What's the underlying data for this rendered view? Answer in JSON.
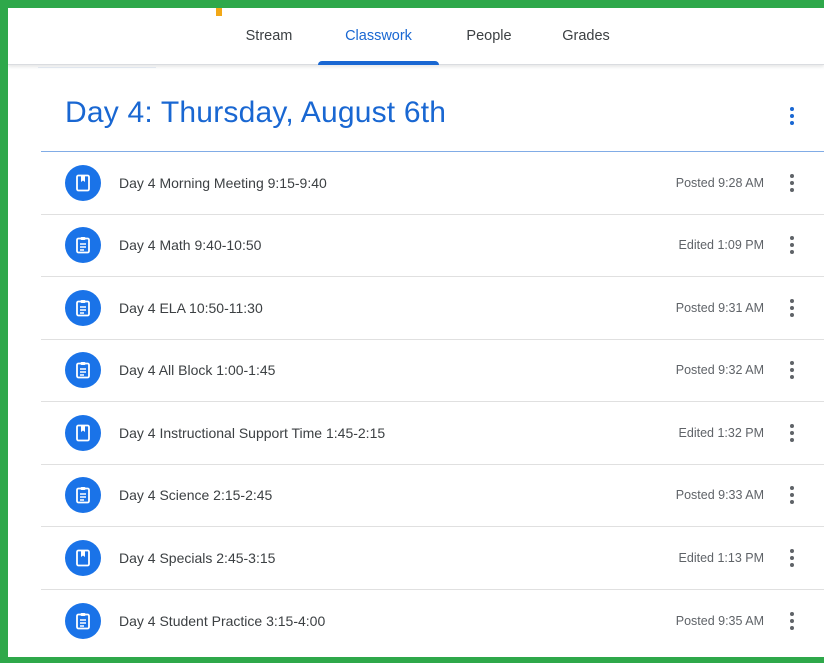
{
  "colors": {
    "accent": "#1967d2",
    "icon_bg": "#1a73e8",
    "frame": "#2ea84a",
    "marker": "#f2a817"
  },
  "nav": {
    "tabs": [
      {
        "label": "Stream",
        "active": false
      },
      {
        "label": "Classwork",
        "active": true
      },
      {
        "label": "People",
        "active": false
      },
      {
        "label": "Grades",
        "active": false
      }
    ]
  },
  "topic": {
    "title": "Day 4: Thursday, August 6th",
    "menu_icon": "more-vert-icon"
  },
  "items": [
    {
      "icon": "material-icon",
      "title": "Day 4 Morning Meeting 9:15-9:40",
      "status": "Posted 9:28 AM"
    },
    {
      "icon": "assignment-icon",
      "title": "Day 4 Math 9:40-10:50",
      "status": "Edited 1:09 PM"
    },
    {
      "icon": "assignment-icon",
      "title": "Day 4 ELA 10:50-11:30",
      "status": "Posted 9:31 AM"
    },
    {
      "icon": "assignment-icon",
      "title": "Day 4 All Block 1:00-1:45",
      "status": "Posted 9:32 AM"
    },
    {
      "icon": "material-icon",
      "title": "Day 4 Instructional Support Time 1:45-2:15",
      "status": "Edited 1:32 PM"
    },
    {
      "icon": "assignment-icon",
      "title": "Day 4 Science 2:15-2:45",
      "status": "Posted 9:33 AM"
    },
    {
      "icon": "material-icon",
      "title": "Day 4 Specials 2:45-3:15",
      "status": "Edited 1:13 PM"
    },
    {
      "icon": "assignment-icon",
      "title": "Day 4 Student Practice 3:15-4:00",
      "status": "Posted 9:35 AM"
    }
  ]
}
